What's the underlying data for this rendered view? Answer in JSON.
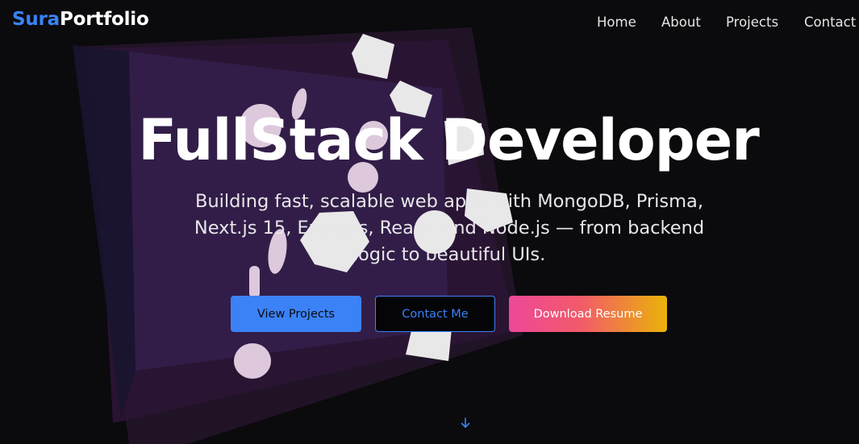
{
  "brand": {
    "name_part1": "Sura",
    "name_part2": "Portfolio",
    "accent_color": "#3b82f6"
  },
  "nav": {
    "items": [
      {
        "label": "Home"
      },
      {
        "label": "About"
      },
      {
        "label": "Projects"
      },
      {
        "label": "Contact"
      }
    ]
  },
  "hero": {
    "title": "FullStack Developer",
    "subtitle": "Building fast, scalable web apps with MongoDB, Prisma, Next.js 15, Express, React, and Node.js — from backend logic to beautiful UIs."
  },
  "buttons": {
    "view_projects": "View Projects",
    "contact_me": "Contact Me",
    "download_resume": "Download Resume"
  },
  "colors": {
    "background": "#0b0a0d",
    "primary": "#3b82f6",
    "gradient_start": "#ec4899",
    "gradient_end": "#eab308"
  },
  "icons": {
    "scroll_down": "arrow-down-icon"
  }
}
